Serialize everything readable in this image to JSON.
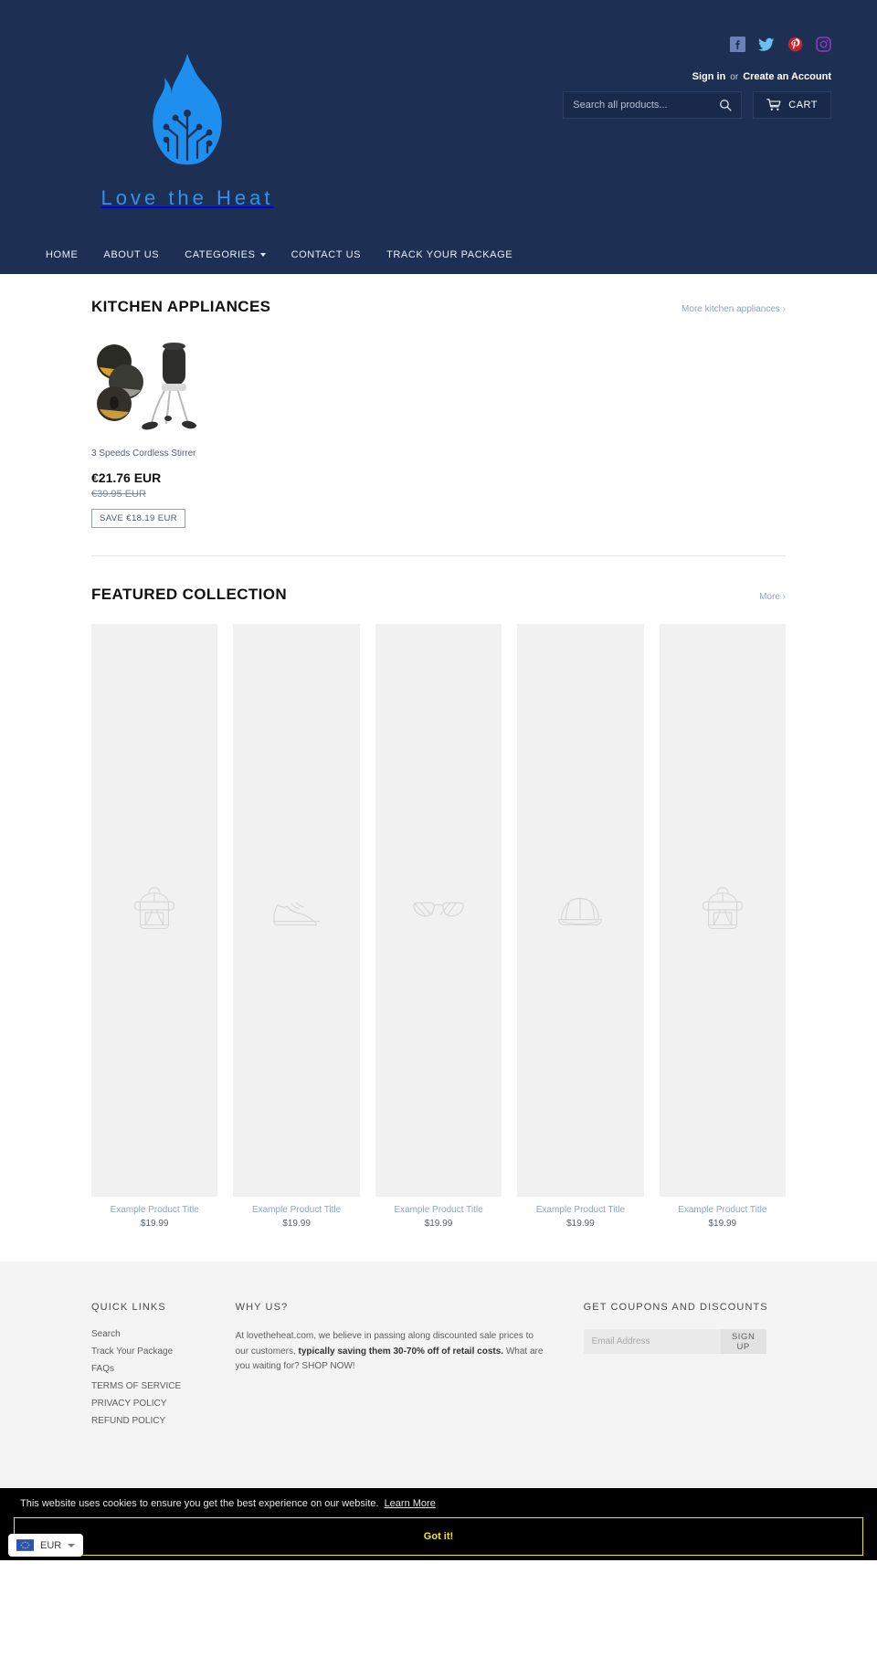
{
  "header": {
    "logo": {
      "wordmark": "Love the Heat",
      "mark_icon": "flame-circuit-logo"
    },
    "social": [
      {
        "name": "facebook-icon",
        "label": "Facebook",
        "color": "#6b7fb8"
      },
      {
        "name": "twitter-icon",
        "label": "Twitter",
        "color": "#55acee"
      },
      {
        "name": "pinterest-icon",
        "label": "Pinterest",
        "color": "#cb2027"
      },
      {
        "name": "instagram-icon",
        "label": "Instagram",
        "color": "#8a3ab9"
      }
    ],
    "account": {
      "sign_in": "Sign in",
      "or": "or",
      "create": "Create an Account"
    },
    "search": {
      "placeholder": "Search all products...",
      "value": "",
      "icon": "search-icon"
    },
    "cart": {
      "label": "CART",
      "icon": "cart-icon"
    },
    "nav": [
      {
        "label": "HOME",
        "has_chevron": false
      },
      {
        "label": "ABOUT US",
        "has_chevron": false
      },
      {
        "label": "CATEGORIES",
        "has_chevron": true
      },
      {
        "label": "CONTACT US",
        "has_chevron": false
      },
      {
        "label": "TRACK YOUR PACKAGE",
        "has_chevron": false
      }
    ]
  },
  "kitchen": {
    "title": "KITCHEN APPLIANCES",
    "more_label": "More kitchen appliances ›",
    "products": [
      {
        "title": "3 Speeds Cordless Stirrer",
        "price": "€21.76 EUR",
        "compare_at": "€39.95 EUR",
        "save_badge": "SAVE €18.19 EUR",
        "image_icon": "cordless-stirrer-photo"
      }
    ]
  },
  "featured": {
    "title": "FEATURED COLLECTION",
    "more_label": "More ›",
    "products": [
      {
        "title": "Example Product Title",
        "price": "$19.99",
        "placeholder_icon": "backpack-icon"
      },
      {
        "title": "Example Product Title",
        "price": "$19.99",
        "placeholder_icon": "shoe-icon"
      },
      {
        "title": "Example Product Title",
        "price": "$19.99",
        "placeholder_icon": "glasses-icon"
      },
      {
        "title": "Example Product Title",
        "price": "$19.99",
        "placeholder_icon": "cap-icon"
      },
      {
        "title": "Example Product Title",
        "price": "$19.99",
        "placeholder_icon": "backpack-icon"
      }
    ]
  },
  "footer": {
    "quick_links": {
      "heading": "QUICK LINKS",
      "items": [
        "Search",
        "Track Your Package",
        "FAQs",
        "TERMS OF SERVICE",
        "PRIVACY POLICY",
        "REFUND POLICY"
      ]
    },
    "why_us": {
      "heading": "WHY US?",
      "text_1": " At lovetheheat.com, we believe in passing along discounted sale prices to our customers, ",
      "text_bold": "typically saving them 30-70% off of retail costs.",
      "text_2": " What are you waiting for? SHOP NOW!"
    },
    "newsletter": {
      "heading": "GET COUPONS AND DISCOUNTS",
      "placeholder": "Email Address",
      "value": "",
      "button": "SIGN UP"
    }
  },
  "cookie": {
    "message": "This website uses cookies to ensure you get the best experience on our website.",
    "learn_more": "Learn More",
    "accept": "Got it!",
    "accent_color": "#f2e60a"
  },
  "currency": {
    "code": "EUR",
    "flag_icon": "eu-flag-icon"
  }
}
